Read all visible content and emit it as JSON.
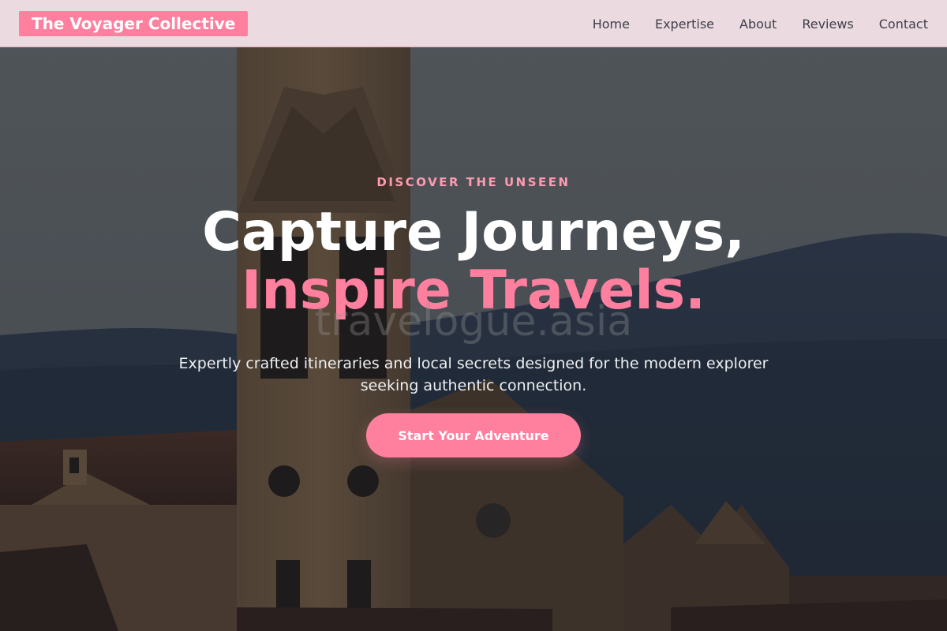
{
  "nav": {
    "brand": "The Voyager Collective",
    "links": [
      "Home",
      "Expertise",
      "About",
      "Reviews",
      "Contact"
    ]
  },
  "hero": {
    "eyebrow": "DISCOVER THE UNSEEN",
    "headline_main": "Capture Journeys,",
    "headline_accent": "Inspire Travels.",
    "watermark": "travelogue.asia",
    "subtext": "Expertly crafted itineraries and local secrets designed for the modern explorer seeking authentic connection.",
    "cta_label": "Start Your Adventure"
  },
  "colors": {
    "accent": "#ff7f9f",
    "nav_bg": "#f8e4ea",
    "nav_text": "#3e3e4a"
  }
}
